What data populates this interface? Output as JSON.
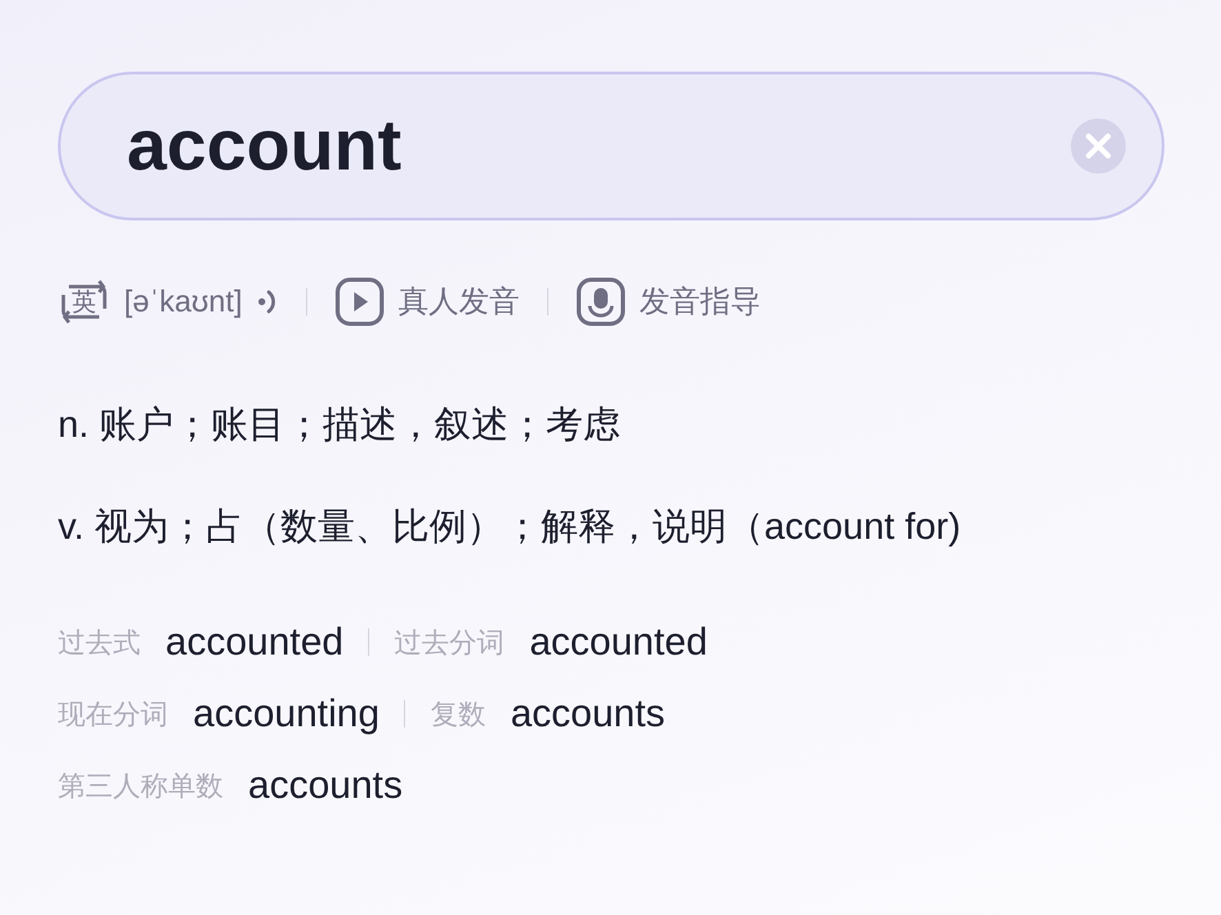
{
  "search": {
    "value": "account"
  },
  "pronunciation": {
    "lang": "英",
    "phonetic": "[əˈkaʊnt]",
    "actions": [
      "真人发音",
      "发音指导"
    ]
  },
  "definitions": [
    {
      "pos": "n.",
      "text": "账户；账目；描述，叙述；考虑"
    },
    {
      "pos": "v.",
      "text": "视为；占（数量、比例）；解释，说明（account for)"
    }
  ],
  "forms": [
    [
      {
        "label": "过去式",
        "value": "accounted"
      },
      {
        "label": "过去分词",
        "value": "accounted"
      }
    ],
    [
      {
        "label": "现在分词",
        "value": "accounting"
      },
      {
        "label": "复数",
        "value": "accounts"
      }
    ],
    [
      {
        "label": "第三人称单数",
        "value": "accounts"
      }
    ]
  ]
}
